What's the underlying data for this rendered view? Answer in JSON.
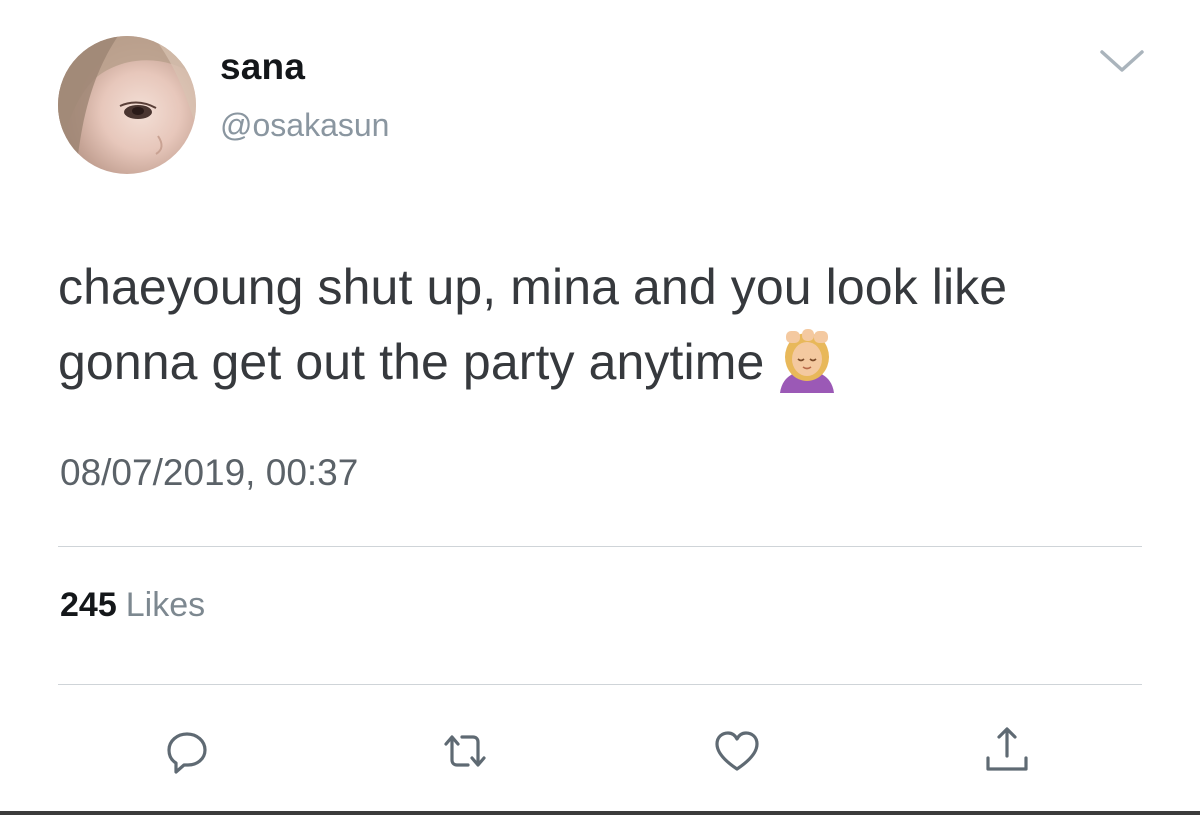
{
  "user": {
    "display_name": "sana",
    "handle": "@osakasun"
  },
  "tweet": {
    "text": "chaeyoung shut up, mina and you look like gonna get out the party anytime",
    "emoji": "face-massage-emoji",
    "timestamp": "08/07/2019, 00:37"
  },
  "stats": {
    "likes_count": "245",
    "likes_label": "Likes"
  },
  "actions": [
    "reply-icon",
    "retweet-icon",
    "like-icon",
    "share-icon"
  ],
  "colors": {
    "text": "#14171a",
    "secondary": "#8a96a0",
    "icon": "#5f6a73",
    "divider": "#cfd4d8"
  }
}
